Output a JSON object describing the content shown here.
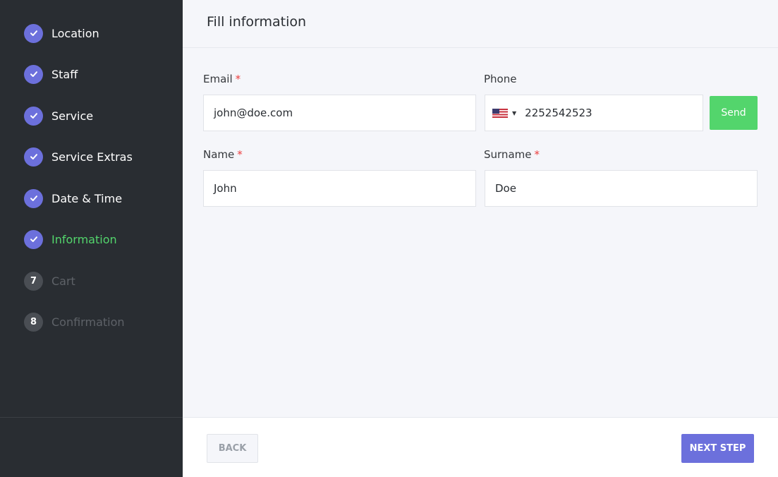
{
  "sidebar": {
    "steps": [
      {
        "label": "Location",
        "status": "done"
      },
      {
        "label": "Staff",
        "status": "done"
      },
      {
        "label": "Service",
        "status": "done"
      },
      {
        "label": "Service Extras",
        "status": "done"
      },
      {
        "label": "Date & Time",
        "status": "done"
      },
      {
        "label": "Information",
        "status": "active"
      },
      {
        "label": "Cart",
        "status": "todo",
        "number": "7"
      },
      {
        "label": "Confirmation",
        "status": "todo",
        "number": "8"
      }
    ]
  },
  "header": {
    "title": "Fill information"
  },
  "form": {
    "email": {
      "label": "Email",
      "required": "*",
      "value": "john@doe.com"
    },
    "phone": {
      "label": "Phone",
      "country_icon": "us-flag-icon",
      "value": "2252542523",
      "send_label": "Send"
    },
    "name": {
      "label": "Name",
      "required": "*",
      "value": "John"
    },
    "surname": {
      "label": "Surname",
      "required": "*",
      "value": "Doe"
    }
  },
  "footer": {
    "back_label": "BACK",
    "next_label": "NEXT STEP"
  },
  "colors": {
    "sidebar_bg": "#292d32",
    "accent": "#6c70dc",
    "success": "#53d56c",
    "required": "#ec3e3e"
  }
}
